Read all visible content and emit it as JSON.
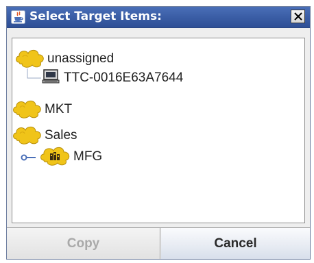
{
  "window": {
    "title": "Select Target Items:",
    "title_icon": "java-cup-icon",
    "close_icon": "close-icon"
  },
  "tree": {
    "nodes": [
      {
        "label": "unassigned",
        "icon": "group-cloud-icon",
        "level": 0
      },
      {
        "label": "TTC-0016E63A7644",
        "icon": "computer-icon",
        "level": 1
      },
      {
        "label": "MKT",
        "icon": "group-cloud-icon",
        "level": 0
      },
      {
        "label": "Sales",
        "icon": "group-cloud-icon",
        "level": 0
      },
      {
        "label": "MFG",
        "icon": "group-cloud-building-icon",
        "level": 1,
        "expand_icon": "expand-handle-icon"
      }
    ]
  },
  "buttons": {
    "copy": {
      "label": "Copy",
      "enabled": false
    },
    "cancel": {
      "label": "Cancel",
      "enabled": true
    }
  },
  "colors": {
    "titlebar": "#3c5fa7",
    "group_icon": "#f0c419",
    "disabled_text": "#a9a9a9"
  }
}
